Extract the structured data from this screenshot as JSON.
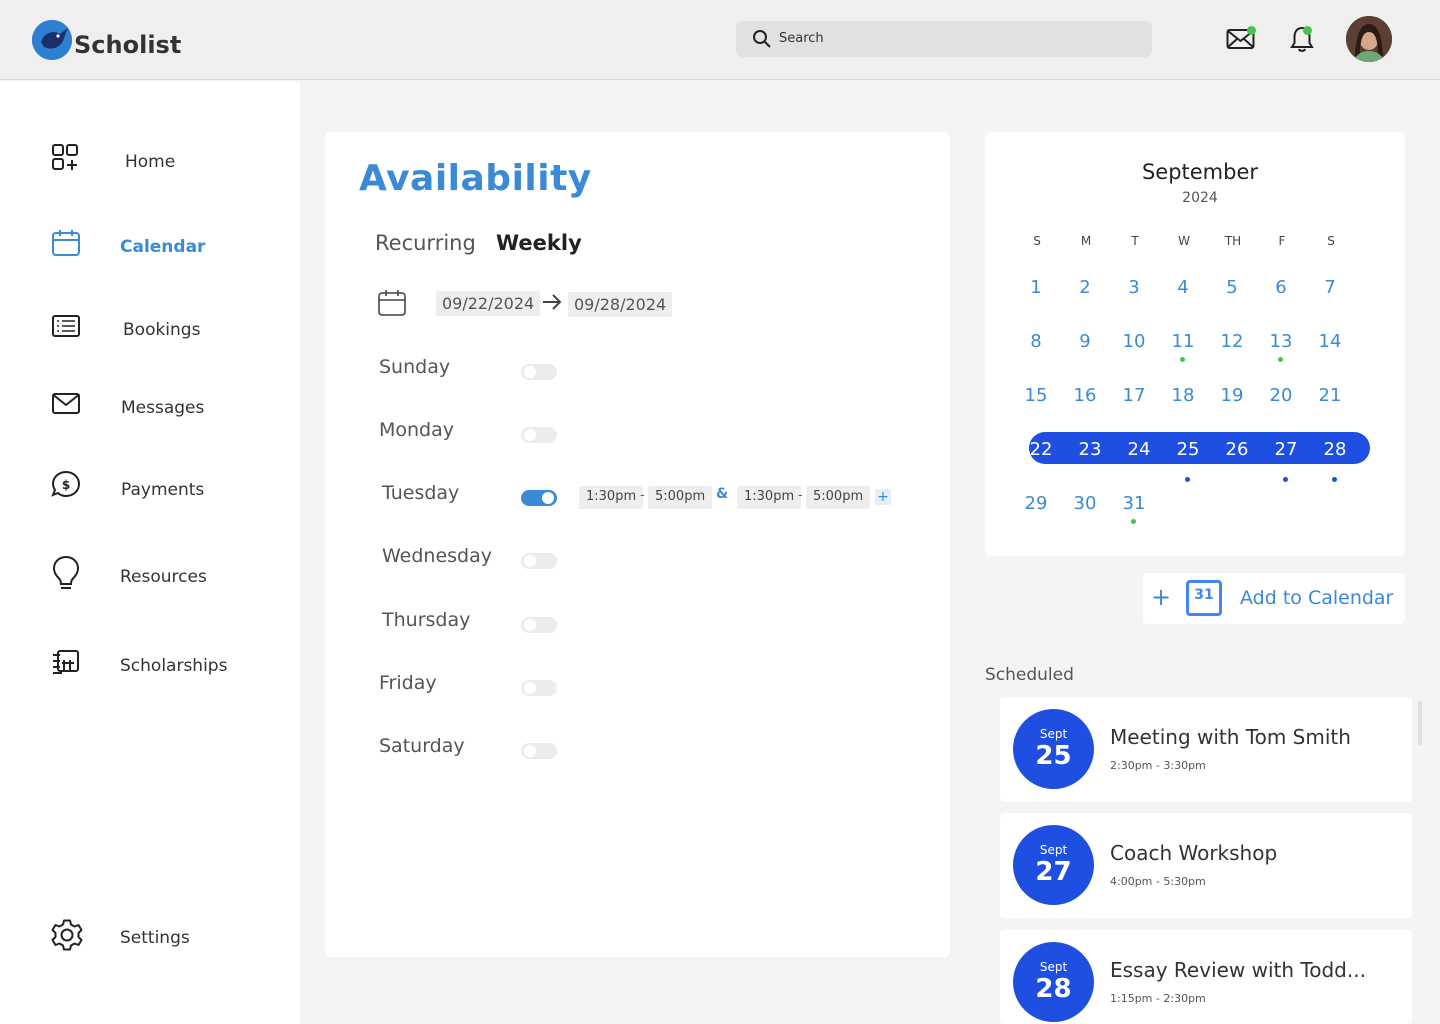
{
  "app": {
    "name": "Scholist"
  },
  "header": {
    "search_placeholder": "Search"
  },
  "colors": {
    "accent": "#3a8ad6",
    "primary_blue": "#1f4fe0",
    "green_dot": "#4bc24b"
  },
  "sidebar": {
    "items": [
      {
        "label": "Home",
        "icon": "grid-plus-icon"
      },
      {
        "label": "Calendar",
        "icon": "calendar-icon",
        "active": true
      },
      {
        "label": "Bookings",
        "icon": "list-icon"
      },
      {
        "label": "Messages",
        "icon": "envelope-icon"
      },
      {
        "label": "Payments",
        "icon": "dollar-bubble-icon"
      },
      {
        "label": "Resources",
        "icon": "lightbulb-icon"
      },
      {
        "label": "Scholarships",
        "icon": "scholarship-icon"
      }
    ],
    "settings_label": "Settings"
  },
  "availability": {
    "title": "Availability",
    "tabs": {
      "recurring": "Recurring",
      "weekly": "Weekly"
    },
    "date_from": "09/22/2024",
    "date_to": "09/28/2024",
    "days": [
      {
        "label": "Sunday",
        "enabled": false
      },
      {
        "label": "Monday",
        "enabled": false
      },
      {
        "label": "Tuesday",
        "enabled": true
      },
      {
        "label": "Wednesday",
        "enabled": false
      },
      {
        "label": "Thursday",
        "enabled": false
      },
      {
        "label": "Friday",
        "enabled": false
      },
      {
        "label": "Saturday",
        "enabled": false
      }
    ],
    "tuesday_slots": {
      "slot1_start": "1:30pm",
      "slot1_end": "5:00pm",
      "slot2_start": "1:30pm",
      "slot2_end": "5:00pm",
      "separator": "-",
      "amp": "&",
      "add": "+"
    }
  },
  "calendar": {
    "month": "September",
    "year": "2024",
    "dow": [
      "S",
      "M",
      "T",
      "W",
      "TH",
      "F",
      "S"
    ],
    "weeks": [
      [
        "1",
        "2",
        "3",
        "4",
        "5",
        "6",
        "7"
      ],
      [
        "8",
        "9",
        "10",
        "11",
        "12",
        "13",
        "14"
      ],
      [
        "15",
        "16",
        "17",
        "18",
        "19",
        "20",
        "21"
      ],
      [
        "22",
        "23",
        "24",
        "25",
        "26",
        "27",
        "28"
      ],
      [
        "29",
        "30",
        "31"
      ]
    ],
    "selected_week": 3,
    "green_dot_days": [
      "11",
      "13",
      "31"
    ],
    "blue_dot_days": [
      "25",
      "27",
      "28"
    ]
  },
  "add_to_calendar": {
    "label": "Add to Calendar",
    "plus": "+",
    "gcal_number": "31"
  },
  "scheduled": {
    "title": "Scheduled",
    "events": [
      {
        "month": "Sept",
        "day": "25",
        "title": "Meeting with Tom Smith",
        "time": "2:30pm - 3:30pm"
      },
      {
        "month": "Sept",
        "day": "27",
        "title": "Coach Workshop",
        "time": "4:00pm - 5:30pm"
      },
      {
        "month": "Sept",
        "day": "28",
        "title": "Essay Review with Todd...",
        "time": "1:15pm - 2:30pm"
      }
    ]
  }
}
